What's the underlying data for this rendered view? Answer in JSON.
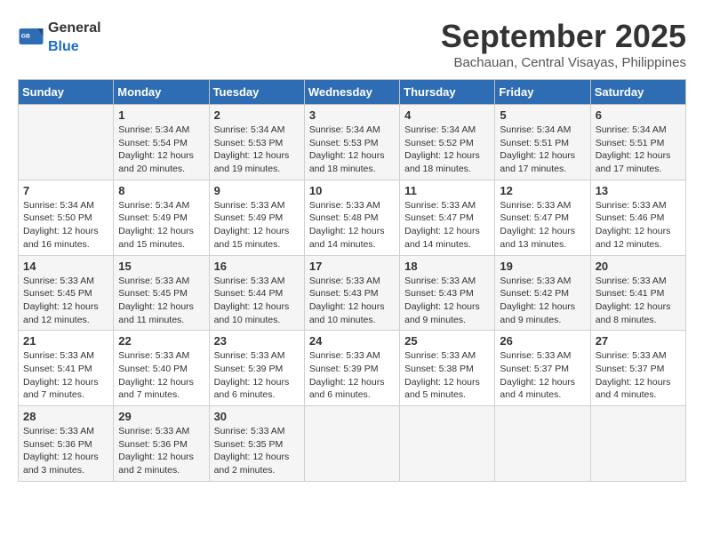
{
  "header": {
    "logo_general": "General",
    "logo_blue": "Blue",
    "month": "September 2025",
    "location": "Bachauan, Central Visayas, Philippines"
  },
  "days_of_week": [
    "Sunday",
    "Monday",
    "Tuesday",
    "Wednesday",
    "Thursday",
    "Friday",
    "Saturday"
  ],
  "weeks": [
    [
      {
        "day": "",
        "info": ""
      },
      {
        "day": "1",
        "info": "Sunrise: 5:34 AM\nSunset: 5:54 PM\nDaylight: 12 hours\nand 20 minutes."
      },
      {
        "day": "2",
        "info": "Sunrise: 5:34 AM\nSunset: 5:53 PM\nDaylight: 12 hours\nand 19 minutes."
      },
      {
        "day": "3",
        "info": "Sunrise: 5:34 AM\nSunset: 5:53 PM\nDaylight: 12 hours\nand 18 minutes."
      },
      {
        "day": "4",
        "info": "Sunrise: 5:34 AM\nSunset: 5:52 PM\nDaylight: 12 hours\nand 18 minutes."
      },
      {
        "day": "5",
        "info": "Sunrise: 5:34 AM\nSunset: 5:51 PM\nDaylight: 12 hours\nand 17 minutes."
      },
      {
        "day": "6",
        "info": "Sunrise: 5:34 AM\nSunset: 5:51 PM\nDaylight: 12 hours\nand 17 minutes."
      }
    ],
    [
      {
        "day": "7",
        "info": "Sunrise: 5:34 AM\nSunset: 5:50 PM\nDaylight: 12 hours\nand 16 minutes."
      },
      {
        "day": "8",
        "info": "Sunrise: 5:34 AM\nSunset: 5:49 PM\nDaylight: 12 hours\nand 15 minutes."
      },
      {
        "day": "9",
        "info": "Sunrise: 5:33 AM\nSunset: 5:49 PM\nDaylight: 12 hours\nand 15 minutes."
      },
      {
        "day": "10",
        "info": "Sunrise: 5:33 AM\nSunset: 5:48 PM\nDaylight: 12 hours\nand 14 minutes."
      },
      {
        "day": "11",
        "info": "Sunrise: 5:33 AM\nSunset: 5:47 PM\nDaylight: 12 hours\nand 14 minutes."
      },
      {
        "day": "12",
        "info": "Sunrise: 5:33 AM\nSunset: 5:47 PM\nDaylight: 12 hours\nand 13 minutes."
      },
      {
        "day": "13",
        "info": "Sunrise: 5:33 AM\nSunset: 5:46 PM\nDaylight: 12 hours\nand 12 minutes."
      }
    ],
    [
      {
        "day": "14",
        "info": "Sunrise: 5:33 AM\nSunset: 5:45 PM\nDaylight: 12 hours\nand 12 minutes."
      },
      {
        "day": "15",
        "info": "Sunrise: 5:33 AM\nSunset: 5:45 PM\nDaylight: 12 hours\nand 11 minutes."
      },
      {
        "day": "16",
        "info": "Sunrise: 5:33 AM\nSunset: 5:44 PM\nDaylight: 12 hours\nand 10 minutes."
      },
      {
        "day": "17",
        "info": "Sunrise: 5:33 AM\nSunset: 5:43 PM\nDaylight: 12 hours\nand 10 minutes."
      },
      {
        "day": "18",
        "info": "Sunrise: 5:33 AM\nSunset: 5:43 PM\nDaylight: 12 hours\nand 9 minutes."
      },
      {
        "day": "19",
        "info": "Sunrise: 5:33 AM\nSunset: 5:42 PM\nDaylight: 12 hours\nand 9 minutes."
      },
      {
        "day": "20",
        "info": "Sunrise: 5:33 AM\nSunset: 5:41 PM\nDaylight: 12 hours\nand 8 minutes."
      }
    ],
    [
      {
        "day": "21",
        "info": "Sunrise: 5:33 AM\nSunset: 5:41 PM\nDaylight: 12 hours\nand 7 minutes."
      },
      {
        "day": "22",
        "info": "Sunrise: 5:33 AM\nSunset: 5:40 PM\nDaylight: 12 hours\nand 7 minutes."
      },
      {
        "day": "23",
        "info": "Sunrise: 5:33 AM\nSunset: 5:39 PM\nDaylight: 12 hours\nand 6 minutes."
      },
      {
        "day": "24",
        "info": "Sunrise: 5:33 AM\nSunset: 5:39 PM\nDaylight: 12 hours\nand 6 minutes."
      },
      {
        "day": "25",
        "info": "Sunrise: 5:33 AM\nSunset: 5:38 PM\nDaylight: 12 hours\nand 5 minutes."
      },
      {
        "day": "26",
        "info": "Sunrise: 5:33 AM\nSunset: 5:37 PM\nDaylight: 12 hours\nand 4 minutes."
      },
      {
        "day": "27",
        "info": "Sunrise: 5:33 AM\nSunset: 5:37 PM\nDaylight: 12 hours\nand 4 minutes."
      }
    ],
    [
      {
        "day": "28",
        "info": "Sunrise: 5:33 AM\nSunset: 5:36 PM\nDaylight: 12 hours\nand 3 minutes."
      },
      {
        "day": "29",
        "info": "Sunrise: 5:33 AM\nSunset: 5:36 PM\nDaylight: 12 hours\nand 2 minutes."
      },
      {
        "day": "30",
        "info": "Sunrise: 5:33 AM\nSunset: 5:35 PM\nDaylight: 12 hours\nand 2 minutes."
      },
      {
        "day": "",
        "info": ""
      },
      {
        "day": "",
        "info": ""
      },
      {
        "day": "",
        "info": ""
      },
      {
        "day": "",
        "info": ""
      }
    ]
  ]
}
